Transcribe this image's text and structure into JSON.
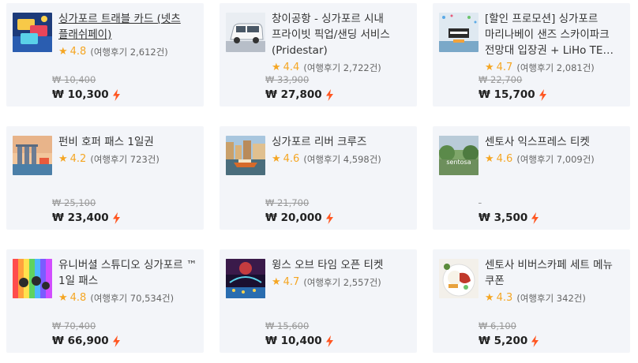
{
  "accent_color": "#f5a623",
  "bolt_color": "#ff5722",
  "products": [
    {
      "title": "싱가포르 트래블 카드 (넷츠 플래쉬페이)",
      "underline": true,
      "rating": "4.8",
      "reviews": "(여행후기 2,612건)",
      "old_price": "₩ 10,400",
      "price": "₩ 10,300",
      "image": "card-image"
    },
    {
      "title": "창이공항 - 싱가포르 시내 프라이빗 픽업/샌딩 서비스 (Pridestar)",
      "underline": false,
      "rating": "4.4",
      "reviews": "(여행후기 2,722건)",
      "old_price": "₩ 33,900",
      "price": "₩ 27,800",
      "image": "van-image"
    },
    {
      "title": "[할인 프로모션] 싱가포르 마리나베이 샌즈 스카이파크 전망대 입장권 + LiHo TE…",
      "underline": false,
      "rating": "4.7",
      "reviews": "(여행후기 2,081건)",
      "old_price": "₩ 22,700",
      "price": "₩ 15,700",
      "image": "skypark-image"
    },
    {
      "title": "펀비 호퍼 패스 1일권",
      "underline": false,
      "rating": "4.2",
      "reviews": "(여행후기 723건)",
      "old_price": "₩ 25,100",
      "price": "₩ 23,400",
      "image": "marina-image"
    },
    {
      "title": "싱가포르 리버 크루즈",
      "underline": false,
      "rating": "4.6",
      "reviews": "(여행후기 4,598건)",
      "old_price": "₩ 21,700",
      "price": "₩ 20,000",
      "image": "cruise-image"
    },
    {
      "title": "센토사 익스프레스 티켓",
      "underline": false,
      "rating": "4.6",
      "reviews": "(여행후기 7,009건)",
      "old_price": "",
      "price": "₩ 3,500",
      "image": "sentosa-image"
    },
    {
      "title": "유니버셜 스튜디오 싱가포르 ™ 1일 패스",
      "underline": false,
      "rating": "4.8",
      "reviews": "(여행후기 70,534건)",
      "old_price": "₩ 70,400",
      "price": "₩ 66,900",
      "image": "universal-image"
    },
    {
      "title": "윙스 오브 타임 오픈 티켓",
      "underline": false,
      "rating": "4.7",
      "reviews": "(여행후기 2,557건)",
      "old_price": "₩ 15,600",
      "price": "₩ 10,400",
      "image": "wings-image"
    },
    {
      "title": "센토사 비버스카페 세트 메뉴 쿠폰",
      "underline": false,
      "rating": "4.3",
      "reviews": "(여행후기 342건)",
      "old_price": "₩ 6,100",
      "price": "₩ 5,200",
      "image": "food-image"
    }
  ],
  "image_texts": {
    "sentosa": "sentosa"
  }
}
